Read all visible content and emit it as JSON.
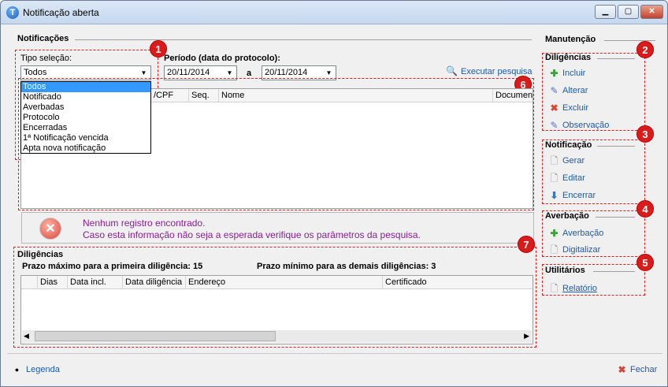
{
  "window": {
    "title": "Notificação aberta",
    "buttons": {
      "minimize": "▁",
      "maximize": "▢",
      "close": "✕"
    }
  },
  "notificacoes": {
    "section_title": "Notificações",
    "tipo_label": "Tipo seleção:",
    "tipo_value": "Todos",
    "tipo_options": [
      "Todos",
      "Notificado",
      "Averbadas",
      "Protocolo",
      "Encerradas",
      "1ª Notificação vencida",
      "Apta nova notificação"
    ],
    "periodo_label": "Período (data do protocolo):",
    "date_from": "20/11/2014",
    "date_sep": "a",
    "date_to": "20/11/2014",
    "executar_label": "Executar pesquisa",
    "grid_columns": [
      "/CPF",
      "Seq.",
      "Nome",
      "Documen"
    ],
    "message_line1": "Nenhum registro encontrado.",
    "message_line2": "Caso esta informação não seja a esperada verifique os parâmetros da pesquisa."
  },
  "diligencias_section": {
    "title": "Diligências",
    "prazo_max": "Prazo máximo para a primeira diligência: 15",
    "prazo_min": "Prazo mínimo para as demais diligências: 3",
    "grid_columns": [
      "Dias",
      "Data incl.",
      "Data diligência",
      "Endereço",
      "Certificado"
    ]
  },
  "manutencao": {
    "title": "Manutenção",
    "diligencias": {
      "title": "Diligências",
      "items": [
        "Incluir",
        "Alterar",
        "Excluir",
        "Observação"
      ]
    },
    "notificacao": {
      "title": "Notificação",
      "items": [
        "Gerar",
        "Editar",
        "Encerrar"
      ]
    },
    "averbacao": {
      "title": "Averbação",
      "items": [
        "Averbação",
        "Digitalizar"
      ]
    },
    "utilitarios": {
      "title": "Utilitários",
      "items": [
        "Relatório"
      ]
    }
  },
  "badges": [
    "1",
    "2",
    "3",
    "4",
    "5",
    "6",
    "7"
  ],
  "footer": {
    "legenda": "Legenda",
    "fechar": "Fechar"
  },
  "icons": {
    "add": "add-icon",
    "edit": "pencil-icon",
    "delete": "delete-icon",
    "doc": "document-icon",
    "down": "down-arrow-icon",
    "search": "search-icon"
  },
  "colors": {
    "accent_link": "#1e5aa8",
    "message": "#8a1e96",
    "marker": "#d81b1b"
  }
}
